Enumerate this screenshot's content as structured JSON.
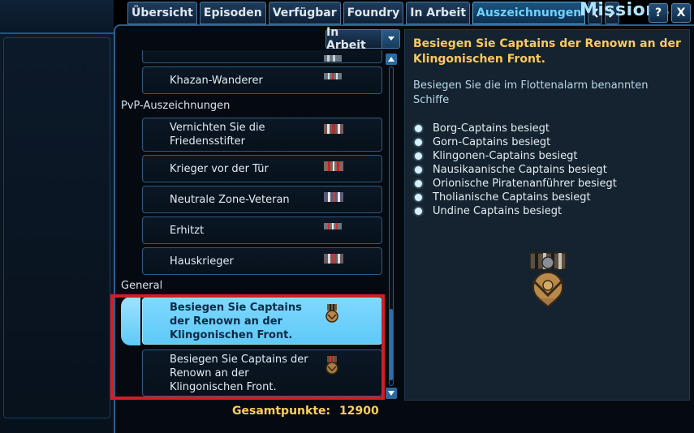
{
  "window": {
    "title": "Missions",
    "help_label": "?",
    "close_label": "X"
  },
  "tabs": [
    {
      "label": "Übersicht",
      "active": false
    },
    {
      "label": "Episoden",
      "active": false
    },
    {
      "label": "Verfügbar",
      "active": false
    },
    {
      "label": "Foundry",
      "active": false
    },
    {
      "label": "In Arbeit",
      "active": false
    },
    {
      "label": "Auszeichnungen",
      "active": true
    }
  ],
  "filter": {
    "selected": "In Arbeit"
  },
  "list": {
    "partial_item": "",
    "items_top": [
      {
        "label": "Khazan-Wanderer"
      }
    ],
    "sections": [
      {
        "title": "PvP-Auszeichnungen",
        "items": [
          {
            "label": "Vernichten Sie die Friedensstifter"
          },
          {
            "label": "Krieger vor der Tür"
          },
          {
            "label": "Neutrale Zone-Veteran"
          },
          {
            "label": "Erhitzt"
          },
          {
            "label": "Hauskrieger"
          }
        ]
      },
      {
        "title": "General",
        "items": [
          {
            "label": "Besiegen Sie Captains der Renown an der Klingonischen Front.",
            "selected": true
          },
          {
            "label": "Besiegen Sie Captains der Renown an der Klingonischen Front.",
            "selected": false
          }
        ]
      }
    ]
  },
  "total": {
    "label": "Gesamtpunkte:",
    "value": "12900"
  },
  "detail": {
    "title": "Besiegen Sie Captains der Renown an der Klingonischen Front.",
    "description": "Besiegen Sie die im Flottenalarm benannten Schiffe",
    "objectives": [
      "Borg-Captains besiegt",
      "Gorn-Captains besiegt",
      "Klingonen-Captains besiegt",
      "Nausikaanische Captains besiegt",
      "Orionische Piratenanführer besiegt",
      "Tholianische Captains besiegt",
      "Undine Captains besiegt"
    ]
  },
  "colors": {
    "accent": "#5ec9f7",
    "title_gold": "#ffc95a",
    "highlight_red": "#d61c24"
  }
}
